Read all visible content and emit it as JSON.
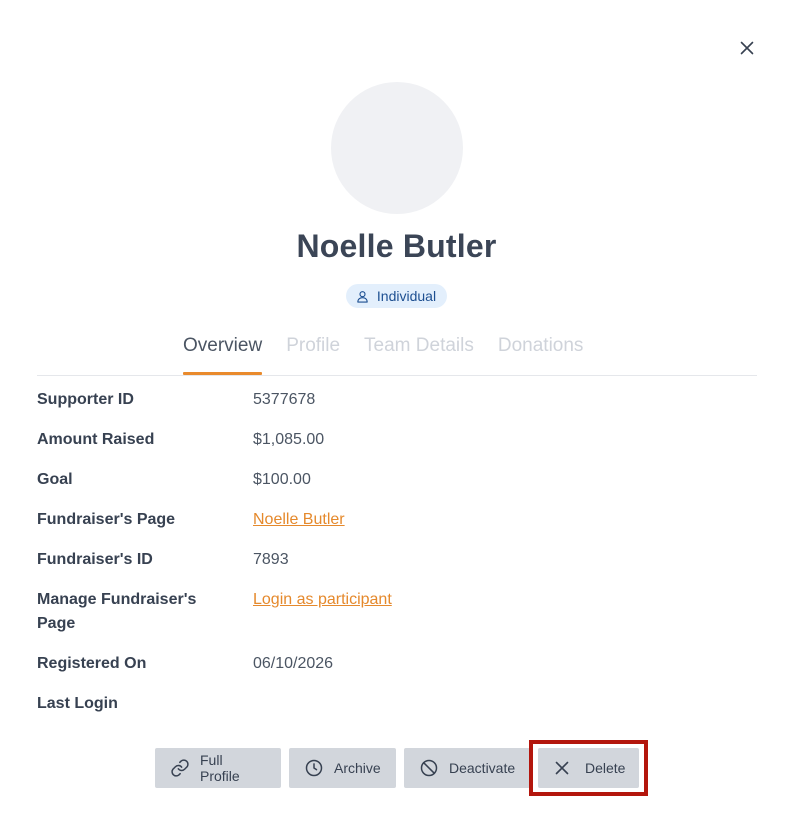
{
  "profile": {
    "name": "Noelle Butler",
    "type_badge": "Individual"
  },
  "tabs": [
    {
      "label": "Overview",
      "active": true
    },
    {
      "label": "Profile",
      "active": false
    },
    {
      "label": "Team Details",
      "active": false
    },
    {
      "label": "Donations",
      "active": false
    }
  ],
  "details": {
    "supporter_id": {
      "label": "Supporter ID",
      "value": "5377678"
    },
    "amount_raised": {
      "label": "Amount Raised",
      "value": "$1,085.00"
    },
    "goal": {
      "label": "Goal",
      "value": "$100.00"
    },
    "fundraiser_page": {
      "label": "Fundraiser's Page",
      "value": "Noelle Butler"
    },
    "fundraiser_id": {
      "label": "Fundraiser's ID",
      "value": "7893"
    },
    "manage_page": {
      "label": "Manage Fundraiser's Page",
      "value": "Login as participant"
    },
    "registered_on": {
      "label": "Registered On",
      "value": "06/10/2026"
    },
    "last_login": {
      "label": "Last Login",
      "value": ""
    }
  },
  "actions": {
    "full_profile": "Full Profile",
    "archive": "Archive",
    "deactivate": "Deactivate",
    "delete": "Delete"
  },
  "colors": {
    "accent": "#e98a2c",
    "badge_bg": "#e3effc",
    "button_bg": "#d2d6dc",
    "highlight_border": "#b3160d"
  }
}
